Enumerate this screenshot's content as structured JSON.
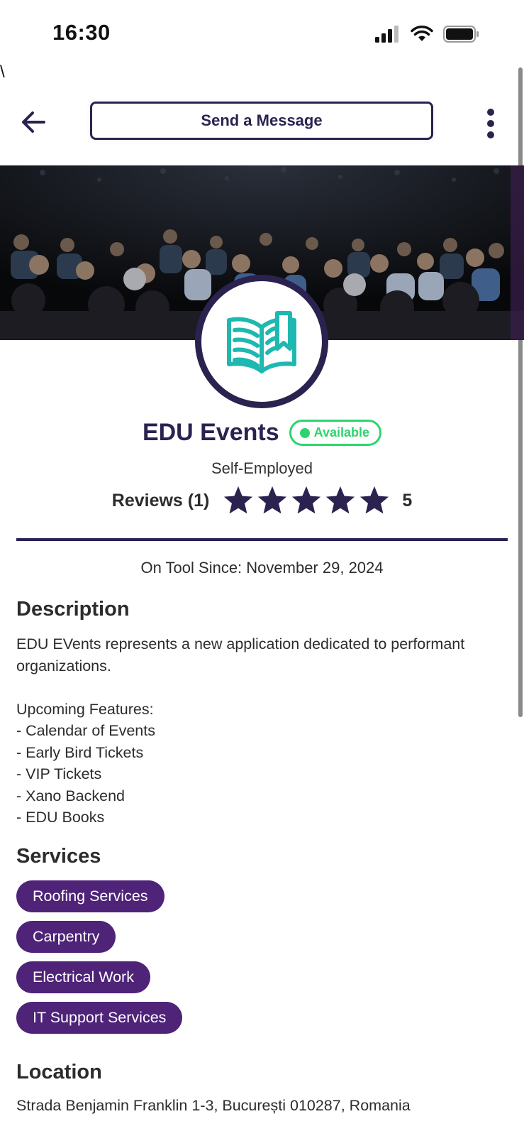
{
  "status_bar": {
    "time": "16:30"
  },
  "stray_text": "\\",
  "header": {
    "send_message_label": "Send a Message"
  },
  "profile": {
    "name": "EDU Events",
    "status": "Available",
    "subtitle": "Self-Employed",
    "reviews_label": "Reviews (1)",
    "rating_value": "5",
    "rating_stars": 5,
    "since": "On Tool Since: November 29, 2024"
  },
  "description": {
    "title": "Description",
    "text": "EDU EVents represents a new application dedicated to performant organizations.\n\nUpcoming Features:\n - Calendar of Events\n - Early Bird Tickets\n - VIP Tickets\n - Xano Backend\n - EDU Books"
  },
  "services": {
    "title": "Services",
    "items": [
      "Roofing Services",
      "Carpentry",
      "Electrical Work",
      "IT Support Services"
    ]
  },
  "location": {
    "title": "Location",
    "address": "Strada Benjamin Franklin 1-3, București 010287, Romania"
  },
  "colors": {
    "primary": "#2b2250",
    "chip": "#4e2378",
    "available": "#2dd36f",
    "logo_teal": "#1fb8b0"
  },
  "icons": {
    "back": "arrow-left-icon",
    "more": "more-vertical-icon",
    "logo": "open-book-bookmark-icon",
    "star": "star-icon"
  }
}
